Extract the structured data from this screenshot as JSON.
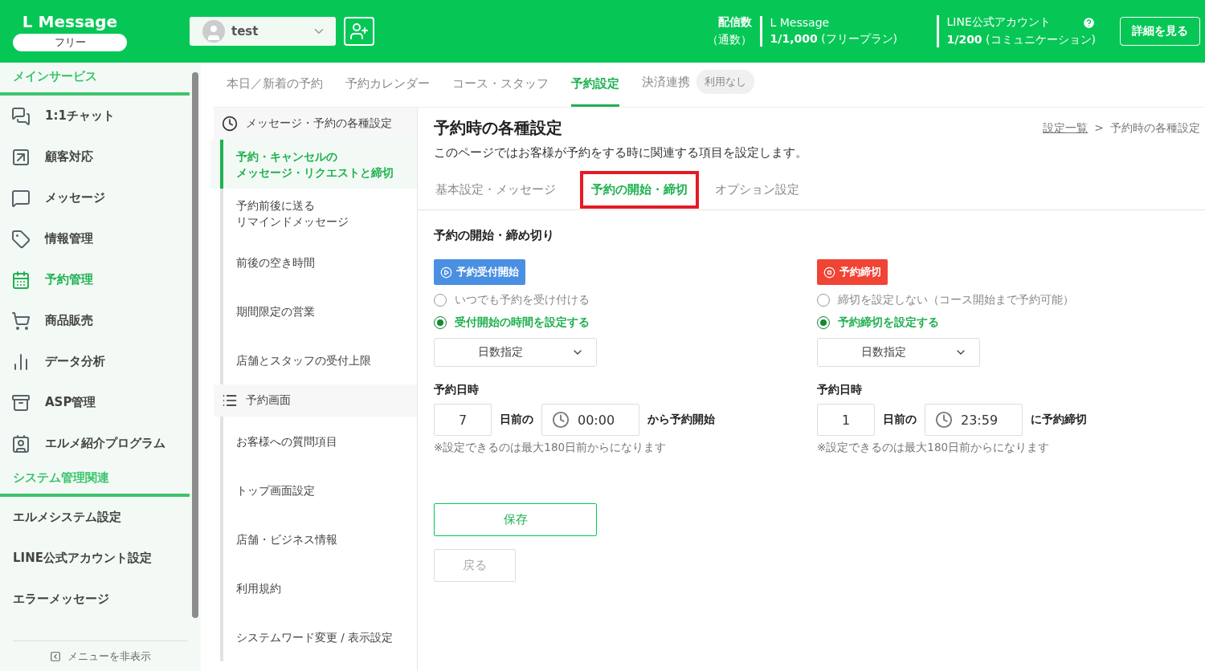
{
  "header": {
    "logo": "L Message",
    "plan": "フリー",
    "account": "test",
    "stats_label": "配信数",
    "stats_sub": "（通数）",
    "stats": [
      {
        "name": "L Message",
        "value": "1/1,000",
        "note": "(フリープラン)"
      },
      {
        "name": "LINE公式アカウント",
        "value": "1/200",
        "note": "(コミュニケーション)"
      }
    ],
    "details_button": "詳細を見る"
  },
  "sidebar": {
    "sections": [
      {
        "title": "メインサービス",
        "items": [
          {
            "label": "1:1チャット",
            "selected": false
          },
          {
            "label": "顧客対応",
            "selected": false
          },
          {
            "label": "メッセージ",
            "selected": false
          },
          {
            "label": "情報管理",
            "selected": false
          },
          {
            "label": "予約管理",
            "selected": true
          },
          {
            "label": "商品販売",
            "selected": false
          },
          {
            "label": "データ分析",
            "selected": false
          },
          {
            "label": "ASP管理",
            "selected": false
          },
          {
            "label": "エルメ紹介プログラム",
            "selected": false
          }
        ]
      },
      {
        "title": "システム管理関連",
        "items": [
          {
            "label": "エルメシステム設定",
            "selected": false
          },
          {
            "label": "LINE公式アカウント設定",
            "selected": false
          },
          {
            "label": "エラーメッセージ",
            "selected": false
          }
        ]
      }
    ],
    "hide_menu": "メニューを非表示"
  },
  "top_tabs": [
    {
      "label": "本日／新着の予約",
      "selected": false
    },
    {
      "label": "予約カレンダー",
      "selected": false
    },
    {
      "label": "コース・スタッフ",
      "selected": false
    },
    {
      "label": "予約設定",
      "selected": true
    },
    {
      "label": "決済連携",
      "selected": false,
      "badge": "利用なし"
    }
  ],
  "subnav": [
    {
      "title": "メッセージ・予約の各種設定",
      "items": [
        {
          "lines": [
            "予約・キャンセルの",
            "メッセージ・リクエストと締切"
          ],
          "selected": true
        },
        {
          "lines": [
            "予約前後に送る",
            "リマインドメッセージ"
          ],
          "selected": false
        },
        {
          "lines": [
            "前後の空き時間"
          ],
          "selected": false
        },
        {
          "lines": [
            "期間限定の営業"
          ],
          "selected": false
        },
        {
          "lines": [
            "店舗とスタッフの受付上限"
          ],
          "selected": false
        }
      ]
    },
    {
      "title": "予約画面",
      "items": [
        {
          "lines": [
            "お客様への質問項目"
          ],
          "selected": false
        },
        {
          "lines": [
            "トップ画面設定"
          ],
          "selected": false
        },
        {
          "lines": [
            "店舗・ビジネス情報"
          ],
          "selected": false
        },
        {
          "lines": [
            "利用規約"
          ],
          "selected": false
        },
        {
          "lines": [
            "システムワード変更 / 表示設定"
          ],
          "selected": false
        }
      ]
    }
  ],
  "main": {
    "title": "予約時の各種設定",
    "breadcrumb": {
      "link": "設定一覧",
      "separator": ">",
      "current": "予約時の各種設定"
    },
    "description": "このページではお客様が予約をする時に関連する項目を設定します。",
    "tabs": [
      {
        "label": "基本設定・メッセージ",
        "selected": false
      },
      {
        "label": "予約の開始・締切",
        "selected": true
      },
      {
        "label": "オプション設定",
        "selected": false
      }
    ],
    "section_title": "予約の開始・締め切り",
    "panels": [
      {
        "kind": "start",
        "badge": "予約受付開始",
        "options": [
          {
            "label": "いつでも予約を受け付ける",
            "selected": false
          },
          {
            "label": "受付開始の時間を設定する",
            "selected": true
          }
        ],
        "select": "日数指定",
        "field_label": "予約日時",
        "days": "7",
        "days_suffix": "日前の",
        "time": "00:00",
        "suffix": "から予約開始",
        "note": "※設定できるのは最大180日前からになります"
      },
      {
        "kind": "end",
        "badge": "予約締切",
        "options": [
          {
            "label": "締切を設定しない（コース開始まで予約可能）",
            "selected": false
          },
          {
            "label": "予約締切を設定する",
            "selected": true
          }
        ],
        "select": "日数指定",
        "field_label": "予約日時",
        "days": "1",
        "days_suffix": "日前の",
        "time": "23:59",
        "suffix": "に予約締切",
        "note": "※設定できるのは最大180日前からになります"
      }
    ],
    "save_button": "保存",
    "back_button": "戻る"
  }
}
